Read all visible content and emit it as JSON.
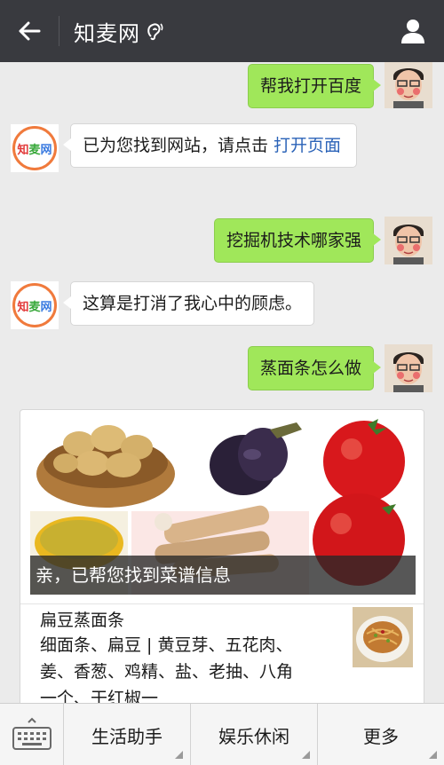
{
  "header": {
    "title": "知麦网",
    "back_icon": "arrow-left-icon",
    "earpiece_icon": "earpiece-mode-icon",
    "profile_icon": "person-icon",
    "background": "#393a3f"
  },
  "bot_logo": {
    "c1": "知",
    "c2": "麦",
    "c3": "网"
  },
  "messages": [
    {
      "side": "out",
      "text": "帮我打开百度"
    },
    {
      "side": "in",
      "text": "已为您找到网站，请点击 ",
      "link": "打开页面"
    },
    {
      "side": "out",
      "text": "挖掘机技术哪家强"
    },
    {
      "side": "in",
      "text": "这算是打消了我心中的顾虑。"
    },
    {
      "side": "out",
      "text": "蒸面条怎么做"
    }
  ],
  "card": {
    "caption": "亲，已帮您找到菜谱信息",
    "recipe_title": "扁豆蒸面条",
    "recipe_desc": "细面条、扁豆 | 黄豆芽、五花肉、姜、香葱、鸡精、盐、老抽、八角一个、干红椒一"
  },
  "bottom_menu": {
    "keyboard_icon": "keyboard-icon",
    "items": [
      "生活助手",
      "娱乐休闲",
      "更多"
    ]
  },
  "colors": {
    "outgoing_bubble": "#a0e75a",
    "incoming_bubble": "#ffffff",
    "link": "#2b63b8"
  }
}
